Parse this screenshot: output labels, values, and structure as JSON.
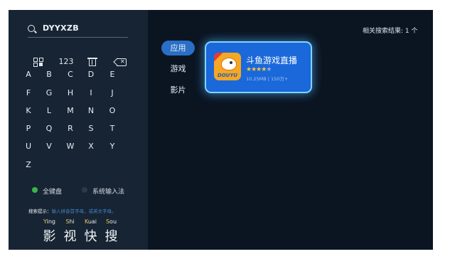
{
  "search": {
    "query": "DYYXZB"
  },
  "keyboard": {
    "num_label": "123",
    "rows": [
      [
        "A",
        "B",
        "C",
        "D",
        "E"
      ],
      [
        "F",
        "G",
        "H",
        "I",
        "J"
      ],
      [
        "K",
        "L",
        "M",
        "N",
        "O"
      ],
      [
        "P",
        "Q",
        "R",
        "S",
        "T"
      ],
      [
        "U",
        "V",
        "W",
        "X",
        "Y"
      ],
      [
        "Z"
      ]
    ]
  },
  "options": {
    "full_keyboard": "全键盘",
    "system_ime": "系统输入法",
    "active_color": "#3ab54a"
  },
  "hint": {
    "label": "搜索提示：",
    "text": "输入拼音首字母，或英文字母。"
  },
  "example": {
    "pinyin": [
      "Ying",
      "Shi",
      "Kuai",
      "Sou"
    ],
    "pinyin_initials": [
      "Y",
      "S",
      "K",
      "S"
    ],
    "pinyin_rest": [
      "ing",
      "hi",
      "uai",
      "ou"
    ],
    "hanzi": [
      "影",
      "视",
      "快",
      "搜"
    ]
  },
  "results": {
    "count_text": "相关搜索结果: 1 个"
  },
  "categories": [
    "应用",
    "游戏",
    "影片"
  ],
  "app": {
    "name": "斗鱼游戏直播",
    "icon_brand": "DOUYU",
    "rating_stars": 4,
    "rating_max": 5,
    "size": "10.25MB",
    "separator": "|",
    "downloads": "150万+",
    "card_color": "#1a68d9"
  }
}
